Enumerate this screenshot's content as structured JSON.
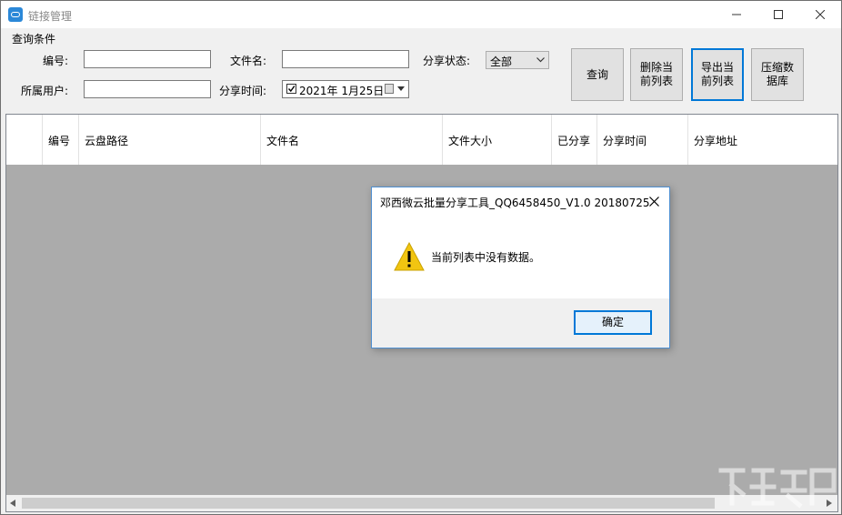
{
  "window": {
    "title": "链接管理"
  },
  "query": {
    "group_label": "查询条件",
    "id_label": "编号:",
    "id_value": "",
    "user_label": "所属用户:",
    "user_value": "",
    "filename_label": "文件名:",
    "filename_value": "",
    "share_time_label": "分享时间:",
    "share_date": "2021年  1月25日",
    "share_date_checked": true,
    "share_status_label": "分享状态:",
    "share_status_value": "全部"
  },
  "buttons": {
    "search": "查询",
    "delete_list": [
      "删除当",
      "前列表"
    ],
    "export_list": [
      "导出当",
      "前列表"
    ],
    "compress_db": [
      "压缩数",
      "据库"
    ]
  },
  "table": {
    "columns": [
      "编号",
      "云盘路径",
      "文件名",
      "文件大小",
      "已分享",
      "分享时间",
      "分享地址"
    ],
    "rows": []
  },
  "dialog": {
    "title": "邓西微云批量分享工具_QQ6458450_V1.0 20180725",
    "message": "当前列表中没有数据。",
    "ok_label": "确定"
  },
  "colors": {
    "accent": "#0078d7",
    "grid_background": "#ababab",
    "warning": "#f2c511"
  }
}
